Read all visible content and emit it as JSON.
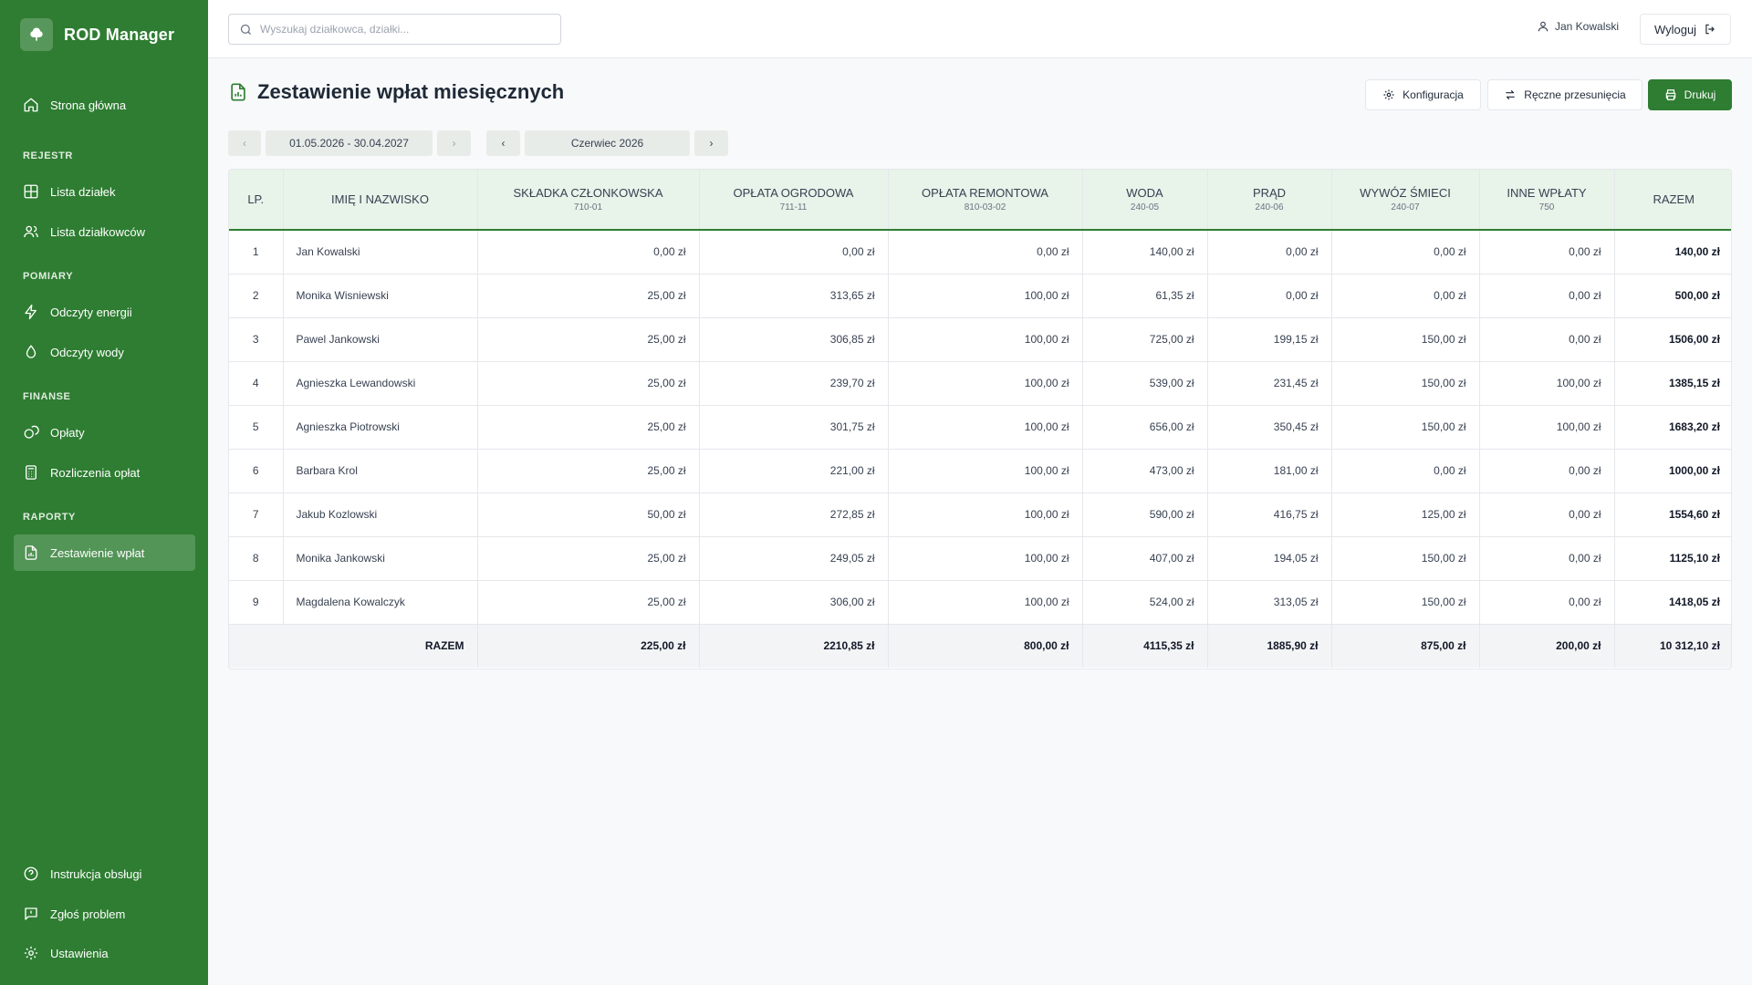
{
  "app": {
    "name": "ROD Manager"
  },
  "sidebar": {
    "home": "Strona główna",
    "sections": [
      "REJESTR",
      "POMIARY",
      "FINANSE",
      "RAPORTY"
    ],
    "items": {
      "plots": "Lista działek",
      "members": "Lista działkowców",
      "energy": "Odczyty energii",
      "water": "Odczyty wody",
      "fees": "Opłaty",
      "settlements": "Rozliczenia opłat",
      "report": "Zestawienie wpłat"
    },
    "bottom": {
      "manual": "Instrukcja obsługi",
      "report_issue": "Zgłoś problem",
      "settings": "Ustawienia"
    }
  },
  "topbar": {
    "search_placeholder": "Wyszukaj działkowca, działki...",
    "user_name": "Jan Kowalski",
    "logout": "Wyloguj"
  },
  "page": {
    "title": "Zestawienie wpłat miesięcznych",
    "buttons": {
      "config": "Konfiguracja",
      "manual_moves": "Ręczne przesunięcia",
      "print": "Drukuj"
    },
    "period": "01.05.2026 - 30.04.2027",
    "month": "Czerwiec 2026"
  },
  "table": {
    "headers": [
      {
        "label": "LP.",
        "code": ""
      },
      {
        "label": "IMIĘ I NAZWISKO",
        "code": ""
      },
      {
        "label": "SKŁADKA CZŁONKOWSKA",
        "code": "710-01"
      },
      {
        "label": "OPŁATA OGRODOWA",
        "code": "711-11"
      },
      {
        "label": "OPŁATA REMONTOWA",
        "code": "810-03-02"
      },
      {
        "label": "WODA",
        "code": "240-05"
      },
      {
        "label": "PRĄD",
        "code": "240-06"
      },
      {
        "label": "WYWÓZ ŚMIECI",
        "code": "240-07"
      },
      {
        "label": "INNE WPŁATY",
        "code": "750"
      },
      {
        "label": "RAZEM",
        "code": ""
      }
    ],
    "rows": [
      [
        "1",
        "Jan Kowalski",
        "0,00 zł",
        "0,00 zł",
        "0,00 zł",
        "140,00 zł",
        "0,00 zł",
        "0,00 zł",
        "0,00 zł",
        "140,00 zł"
      ],
      [
        "2",
        "Monika Wisniewski",
        "25,00 zł",
        "313,65 zł",
        "100,00 zł",
        "61,35 zł",
        "0,00 zł",
        "0,00 zł",
        "0,00 zł",
        "500,00 zł"
      ],
      [
        "3",
        "Pawel Jankowski",
        "25,00 zł",
        "306,85 zł",
        "100,00 zł",
        "725,00 zł",
        "199,15 zł",
        "150,00 zł",
        "0,00 zł",
        "1506,00 zł"
      ],
      [
        "4",
        "Agnieszka Lewandowski",
        "25,00 zł",
        "239,70 zł",
        "100,00 zł",
        "539,00 zł",
        "231,45 zł",
        "150,00 zł",
        "100,00 zł",
        "1385,15 zł"
      ],
      [
        "5",
        "Agnieszka Piotrowski",
        "25,00 zł",
        "301,75 zł",
        "100,00 zł",
        "656,00 zł",
        "350,45 zł",
        "150,00 zł",
        "100,00 zł",
        "1683,20 zł"
      ],
      [
        "6",
        "Barbara Krol",
        "25,00 zł",
        "221,00 zł",
        "100,00 zł",
        "473,00 zł",
        "181,00 zł",
        "0,00 zł",
        "0,00 zł",
        "1000,00 zł"
      ],
      [
        "7",
        "Jakub Kozlowski",
        "50,00 zł",
        "272,85 zł",
        "100,00 zł",
        "590,00 zł",
        "416,75 zł",
        "125,00 zł",
        "0,00 zł",
        "1554,60 zł"
      ],
      [
        "8",
        "Monika Jankowski",
        "25,00 zł",
        "249,05 zł",
        "100,00 zł",
        "407,00 zł",
        "194,05 zł",
        "150,00 zł",
        "0,00 zł",
        "1125,10 zł"
      ],
      [
        "9",
        "Magdalena Kowalczyk",
        "25,00 zł",
        "306,00 zł",
        "100,00 zł",
        "524,00 zł",
        "313,05 zł",
        "150,00 zł",
        "0,00 zł",
        "1418,05 zł"
      ]
    ],
    "total": [
      "RAZEM",
      "225,00 zł",
      "2210,85 zł",
      "800,00 zł",
      "4115,35 zł",
      "1885,90 zł",
      "875,00 zł",
      "200,00 zł",
      "10 312,10 zł"
    ]
  }
}
